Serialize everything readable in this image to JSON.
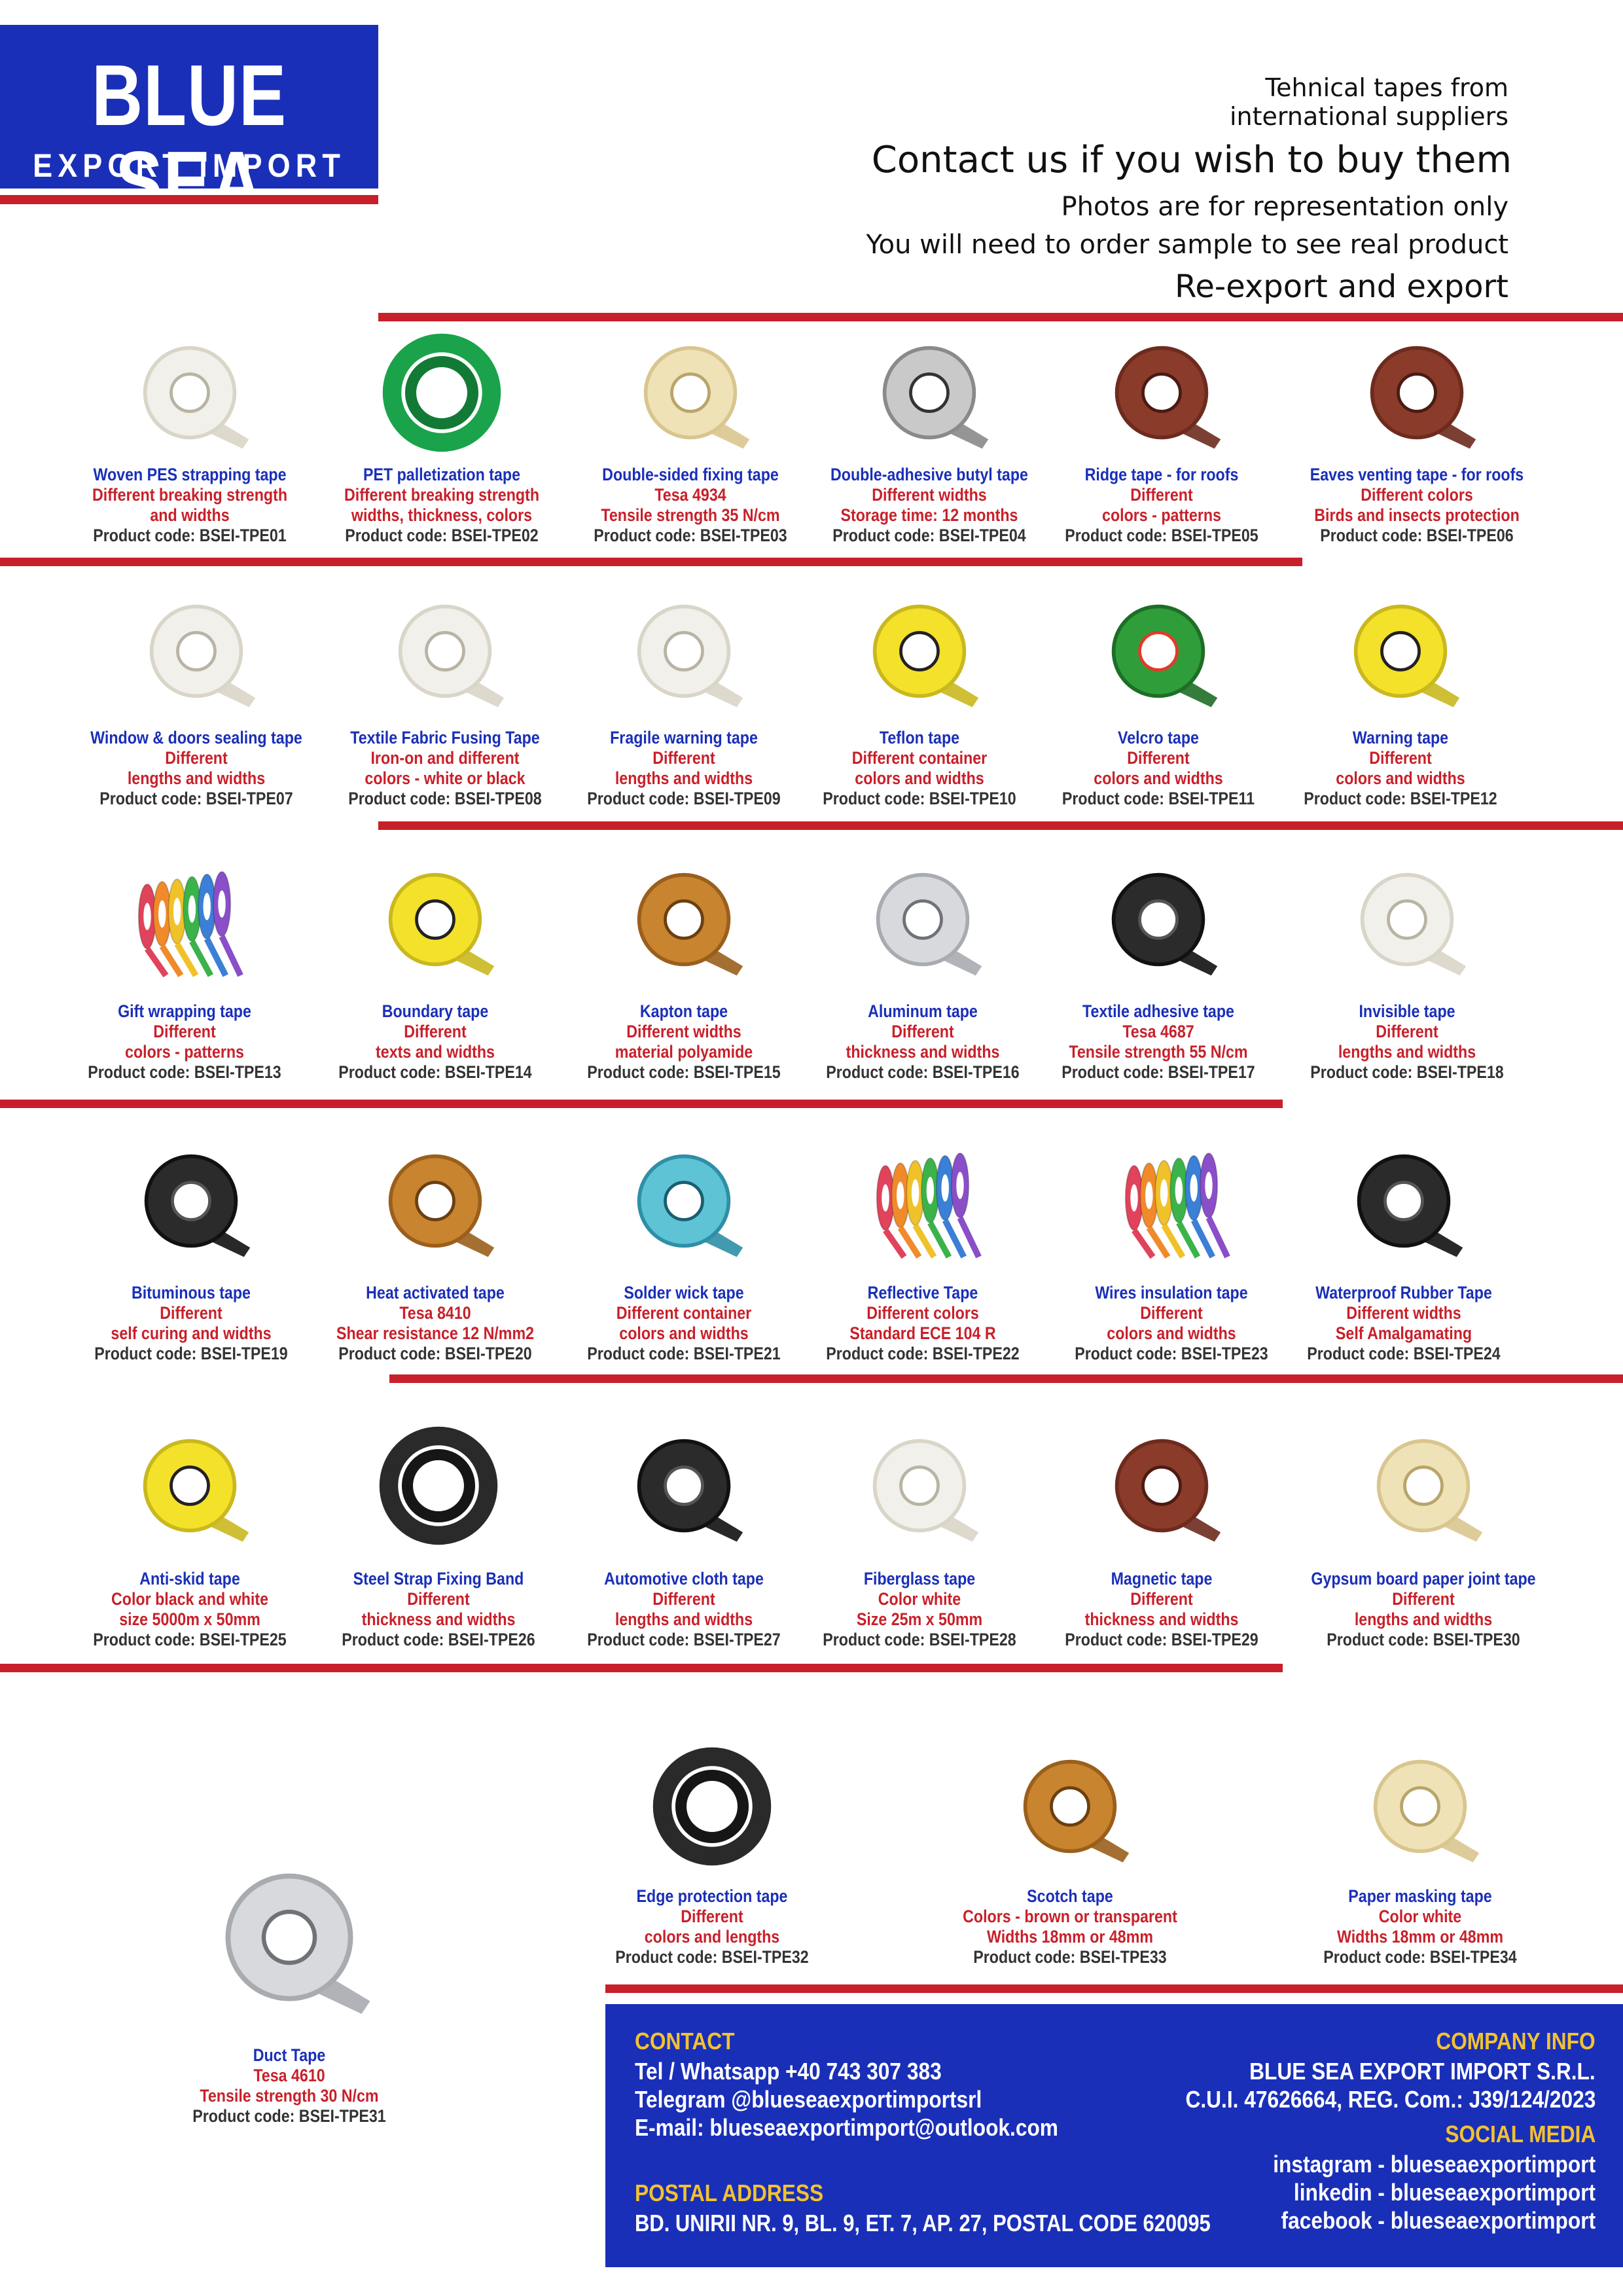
{
  "logo": {
    "line1": "BLUE SEA",
    "line2": "EXPORT IMPORT"
  },
  "header": {
    "line1": "Tehnical tapes from",
    "line2": "international suppliers",
    "line3": "Contact us if you wish to buy them",
    "line4": "Photos are for representation only",
    "line5": "You will need to order sample to see real product",
    "line6": "Re-export and export"
  },
  "products": [
    {
      "name": "Woven PES strapping tape",
      "d1": "Different breaking strength",
      "d2": "and widths",
      "code": "Product code: BSEI-TPE01",
      "img": "white-roll"
    },
    {
      "name": "PET palletization tape",
      "d1": "Different breaking strength",
      "d2": "widths, thickness, colors",
      "code": "Product code: BSEI-TPE02",
      "img": "green-coil"
    },
    {
      "name": "Double-sided fixing tape",
      "d1": "Tesa 4934",
      "d2": "Tensile strength 35 N/cm",
      "code": "Product code: BSEI-TPE03",
      "img": "beige-roll"
    },
    {
      "name": "Double-adhesive butyl tape",
      "d1": "Different widths",
      "d2": "Storage time: 12 months",
      "code": "Product code: BSEI-TPE04",
      "img": "grey-roll"
    },
    {
      "name": "Ridge tape - for roofs",
      "d1": "Different",
      "d2": "colors - patterns",
      "code": "Product code: BSEI-TPE05",
      "img": "brown-roll"
    },
    {
      "name": "Eaves venting tape - for roofs",
      "d1": "Different colors",
      "d2": "Birds and insects protection",
      "code": "Product code: BSEI-TPE06",
      "img": "brown-roll"
    },
    {
      "name": "Window &  doors sealing tape",
      "d1": "Different",
      "d2": "lengths and widths",
      "code": "Product code: BSEI-TPE07",
      "img": "white-roll"
    },
    {
      "name": "Textile Fabric Fusing Tape",
      "d1": "Iron-on and different",
      "d2": "colors - white or black",
      "code": "Product code: BSEI-TPE08",
      "img": "white-roll"
    },
    {
      "name": "Fragile warning tape",
      "d1": "Different",
      "d2": "lengths and widths",
      "code": "Product code: BSEI-TPE09",
      "img": "white-roll"
    },
    {
      "name": "Teflon tape",
      "d1": "Different container",
      "d2": "colors and widths",
      "code": "Product code: BSEI-TPE10",
      "img": "yellow-roll"
    },
    {
      "name": "Velcro tape",
      "d1": "Different",
      "d2": "colors and widths",
      "code": "Product code: BSEI-TPE11",
      "img": "green-roll"
    },
    {
      "name": "Warning tape",
      "d1": "Different",
      "d2": "colors and widths",
      "code": "Product code: BSEI-TPE12",
      "img": "yellow-roll"
    },
    {
      "name": "Gift wrapping tape",
      "d1": "Different",
      "d2": "colors - patterns",
      "code": "Product code: BSEI-TPE13",
      "img": "multi-rolls"
    },
    {
      "name": "Boundary tape",
      "d1": "Different",
      "d2": "texts and widths",
      "code": "Product code: BSEI-TPE14",
      "img": "yellow-roll"
    },
    {
      "name": "Kapton tape",
      "d1": "Different widths",
      "d2": "material polyamide",
      "code": "Product code: BSEI-TPE15",
      "img": "amber-roll"
    },
    {
      "name": "Aluminum tape",
      "d1": "Different",
      "d2": "thickness and widths",
      "code": "Product code: BSEI-TPE16",
      "img": "silver-roll"
    },
    {
      "name": "Textile adhesive tape",
      "d1": "Tesa 4687",
      "d2": "Tensile strength 55 N/cm",
      "code": "Product code: BSEI-TPE17",
      "img": "black-roll"
    },
    {
      "name": "Invisible tape",
      "d1": "Different",
      "d2": "lengths and widths",
      "code": "Product code: BSEI-TPE18",
      "img": "white-roll"
    },
    {
      "name": "Bituminous tape",
      "d1": "Different",
      "d2": "self curing and widths",
      "code": "Product code: BSEI-TPE19",
      "img": "black-roll"
    },
    {
      "name": "Heat activated tape",
      "d1": "Tesa 8410",
      "d2": "Shear resistance 12 N/mm2",
      "code": "Product code: BSEI-TPE20",
      "img": "amber-roll"
    },
    {
      "name": "Solder wick tape",
      "d1": "Different container",
      "d2": "colors and widths",
      "code": "Product code: BSEI-TPE21",
      "img": "cyan-spool"
    },
    {
      "name": "Reflective Tape",
      "d1": "Different colors",
      "d2": "Standard ECE 104 R",
      "code": "Product code: BSEI-TPE22",
      "img": "multi-rolls"
    },
    {
      "name": "Wires insulation tape",
      "d1": "Different",
      "d2": "colors and widths",
      "code": "Product code: BSEI-TPE23",
      "img": "multi-rolls"
    },
    {
      "name": "Waterproof Rubber Tape",
      "d1": "Different widths",
      "d2": "Self Amalgamating",
      "code": "Product code: BSEI-TPE24",
      "img": "black-roll"
    },
    {
      "name": "Anti-skid tape",
      "d1": "Color black and white",
      "d2": "size 5000m x 50mm",
      "code": "Product code: BSEI-TPE25",
      "img": "yellow-roll"
    },
    {
      "name": "Steel Strap Fixing Band",
      "d1": "Different",
      "d2": "thickness and widths",
      "code": "Product code: BSEI-TPE26",
      "img": "black-coil"
    },
    {
      "name": "Automotive cloth tape",
      "d1": "Different",
      "d2": "lengths and widths",
      "code": "Product code: BSEI-TPE27",
      "img": "black-roll"
    },
    {
      "name": "Fiberglass tape",
      "d1": "Color white",
      "d2": "Size 25m x 50mm",
      "code": "Product code: BSEI-TPE28",
      "img": "white-roll"
    },
    {
      "name": "Magnetic tape",
      "d1": "Different",
      "d2": "thickness and widths",
      "code": "Product code: BSEI-TPE29",
      "img": "brown-roll"
    },
    {
      "name": "Gypsum board paper joint tape",
      "d1": "Different",
      "d2": "lengths and widths",
      "code": "Product code: BSEI-TPE30",
      "img": "beige-roll"
    },
    {
      "name": "Duct Tape",
      "d1": "Tesa 4610",
      "d2": "Tensile strength 30 N/cm",
      "code": "Product code: BSEI-TPE31",
      "img": "silver-roll"
    },
    {
      "name": "Edge protection tape",
      "d1": "Different",
      "d2": "colors and lengths",
      "code": "Product code: BSEI-TPE32",
      "img": "black-coil"
    },
    {
      "name": "Scotch tape",
      "d1": "Colors - brown or transparent",
      "d2": "Widths 18mm or 48mm",
      "code": "Product code: BSEI-TPE33",
      "img": "amber-roll"
    },
    {
      "name": "Paper masking tape",
      "d1": "Color white",
      "d2": "Widths 18mm or 48mm",
      "code": "Product code: BSEI-TPE34",
      "img": "beige-roll"
    }
  ],
  "contact": {
    "heading": "CONTACT",
    "phone": "Tel / Whatsapp +40 743 307 383",
    "telegram": "Telegram @blueseaexportimportsrl",
    "email": "E-mail: blueseaexportimport@outlook.com",
    "postal_heading": "POSTAL ADDRESS",
    "postal": "BD. UNIRII NR. 9, BL. 9, ET. 7, AP. 27, POSTAL CODE 620095"
  },
  "company": {
    "heading": "COMPANY INFO",
    "name": "BLUE SEA EXPORT IMPORT S.R.L.",
    "reg": "C.U.I. 47626664, REG. Com.: J39/124/2023",
    "social_heading": "SOCIAL MEDIA",
    "instagram": "instagram - blueseaexportimport",
    "linkedin": "linkedin - blueseaexportimport",
    "facebook": "facebook - blueseaexportimport"
  },
  "colors": {
    "blue": "#1a2fb8",
    "red": "#c8202a",
    "yellow": "#f2c230"
  }
}
